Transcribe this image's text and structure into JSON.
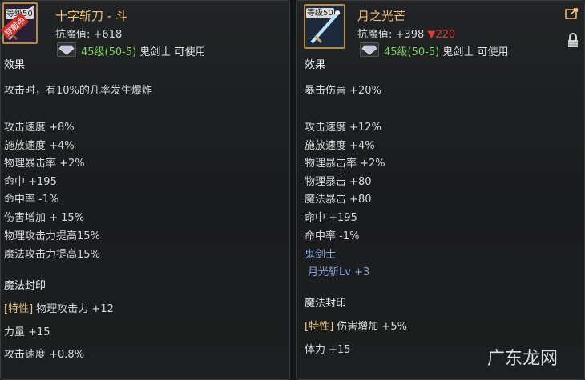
{
  "left": {
    "level_badge": "等级50",
    "equipped_badge": "穿戴中",
    "name": "十字斩刀 - 斗",
    "resist_label": "抗魔值:",
    "resist_value": "+618",
    "requirement_level": "45级(50-5)",
    "requirement_class": "鬼剑士 可使用",
    "effect_title": "效果",
    "effect_text": "攻击时，有10%的几率发生爆炸",
    "stats": [
      "攻击速度 +8%",
      "施放速度 +4%",
      "物理暴击率 +2%",
      "命中 +195",
      "命中率 -1%",
      "伤害增加 + 15%",
      "物理攻击力提高15%",
      "魔法攻击力提高15%"
    ],
    "seal_title": "魔法封印",
    "seal_trait_tag": "[特性]",
    "seal_trait": "物理攻击力 +12",
    "seal_stats": [
      "力量 +15",
      "攻击速度 +0.8%"
    ]
  },
  "right": {
    "level_badge": "等级50",
    "name": "月之光芒",
    "resist_label": "抗魔值:",
    "resist_value": "+398",
    "resist_diff": "▼220",
    "requirement_level": "45级(50-5)",
    "requirement_class": "鬼剑士 可使用",
    "effect_title": "效果",
    "stats": [
      "暴击伤害 +20%",
      "",
      "攻击速度 +12%",
      "施放速度 +4%",
      "物理暴击率 +2%",
      "物理暴击 +80",
      "魔法暴击 +80",
      "命中 +195",
      "命中率 -1%"
    ],
    "class_title": "鬼剑士",
    "class_skill": "月光斩Lv +3",
    "seal_title": "魔法封印",
    "seal_trait_tag": "[特性]",
    "seal_trait": "伤害增加 +5%",
    "seal_stats": [
      "体力 +15"
    ]
  },
  "watermark": "广东龙网",
  "colors": {
    "name": "#f2c27b",
    "requirement": "#7ad064",
    "decrease": "#e03a34",
    "class_skill": "#7fa4d8",
    "trait": "#e5c37b"
  },
  "icons": [
    "sword-icon",
    "gem-icon",
    "share-icon",
    "lock-icon"
  ]
}
